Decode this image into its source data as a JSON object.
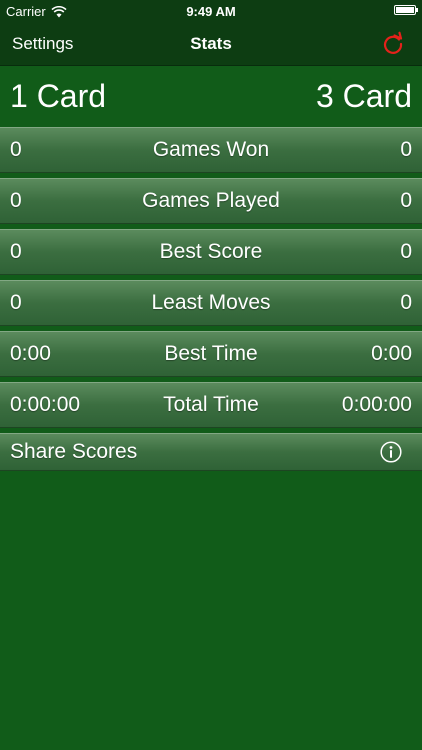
{
  "status_bar": {
    "carrier": "Carrier",
    "time": "9:49 AM",
    "wifi_icon": "wifi-icon",
    "battery_icon": "battery-icon"
  },
  "nav": {
    "left_button": "Settings",
    "title": "Stats",
    "right_icon": "reset-icon"
  },
  "colors": {
    "background": "#115c19",
    "bar_background": "#0d3d12",
    "row_top": "#5b8b5d",
    "row_bottom": "#2f6236",
    "reset_icon": "#e3221b",
    "text": "#ffffff"
  },
  "header": {
    "left": "1 Card",
    "right": "3 Card"
  },
  "stats": [
    {
      "label": "Games Won",
      "one_card": "0",
      "three_card": "0"
    },
    {
      "label": "Games Played",
      "one_card": "0",
      "three_card": "0"
    },
    {
      "label": "Best Score",
      "one_card": "0",
      "three_card": "0"
    },
    {
      "label": "Least Moves",
      "one_card": "0",
      "three_card": "0"
    },
    {
      "label": "Best Time",
      "one_card": "0:00",
      "three_card": "0:00"
    },
    {
      "label": "Total Time",
      "one_card": "0:00:00",
      "three_card": "0:00:00"
    }
  ],
  "share": {
    "label": "Share Scores",
    "icon": "info-icon"
  }
}
